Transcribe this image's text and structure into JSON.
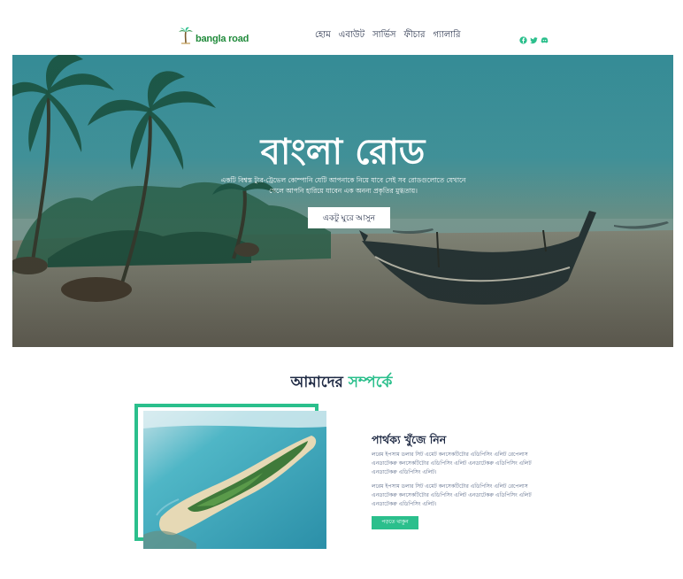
{
  "brand": {
    "name": "bangla road"
  },
  "nav": {
    "items": [
      {
        "label": "হোম"
      },
      {
        "label": "এবাউট"
      },
      {
        "label": "সার্ভিস"
      },
      {
        "label": "ফীচার"
      },
      {
        "label": "গ্যালারি"
      }
    ],
    "social_icons": [
      "facebook-icon",
      "twitter-icon",
      "discord-icon"
    ]
  },
  "hero": {
    "title": "বাংলা রোড",
    "subtitle": "একটি বিশ্বস্ত ট্যুর-ট্রেভেল কোম্পানি যেটি আপনাকে নিয়ে যাবে সেই সব রোডগুলোতে যেখানে গেলে আপনি হারিয়ে যাবেন এক অনন্য প্রকৃতির মুগ্ধতায়।",
    "button_label": "একটু ঘুরে আসুন"
  },
  "about": {
    "title_main": "আমাদের",
    "title_accent": "সম্পর্কে",
    "heading": "পার্থক্য খুঁজে নিন",
    "paragraph_1": "লরেম ইপসাম ডলার সিট এমেট কনসেকটিটোর এডিপিসিং এলিট রেপেলাস এনডাটেকরু কনসেকটিটোর এডিপিসিং এলিট এনডাটেকরু এডিপিসিং এলিট এনডাটেকরু এডিপিসিং এলিট।",
    "paragraph_2": "লরেম ইপসাম ডলার সিট এমেট কনসেকটিটোর এডিপিসিং এলিট রেপেলাস এনডাটেকরু কনসেকটিটোর এডিপিসিং এলিট এনডাটেকরু এডিপিসিং এলিট এনডাটেকরু এডিপিসিং এলিট।",
    "button_label": "পড়তে থাকুন"
  },
  "colors": {
    "accent": "#2bbf8c",
    "text_dark": "#1f2a44",
    "logo_green": "#1f8a3a"
  }
}
